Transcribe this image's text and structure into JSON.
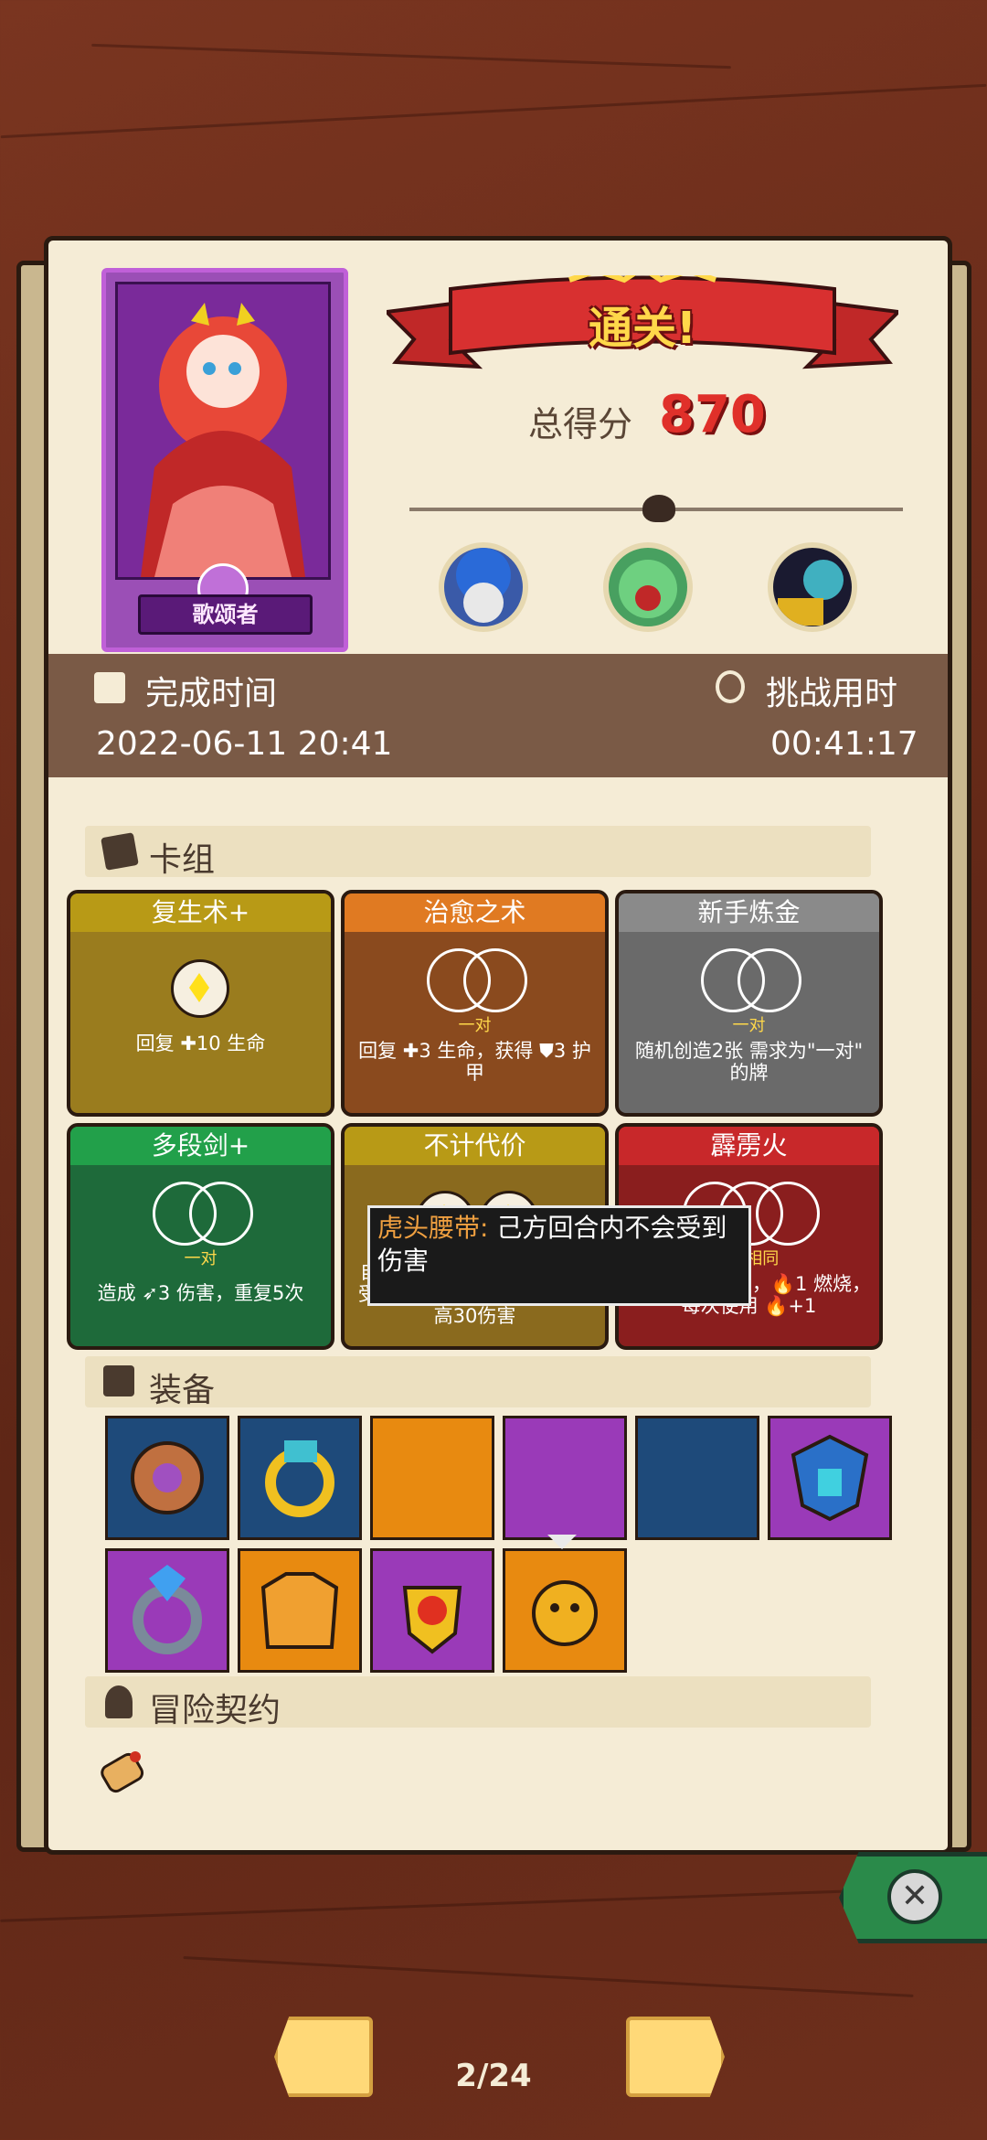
{
  "hero": {
    "name": "歌颂者"
  },
  "result": {
    "banner": "通关!",
    "score_label": "总得分",
    "score_value": "870"
  },
  "info": {
    "finish_label": "完成时间",
    "finish_value": "2022-06-11 20:41",
    "challenge_label": "挑战用时",
    "challenge_value": "00:41:17"
  },
  "sections": {
    "deck": "卡组",
    "equipment": "装备",
    "contract": "冒险契约"
  },
  "cards": [
    {
      "name": "复生术+",
      "tag": "",
      "desc": "回复 ✚10 生命",
      "color": "#9a7c1e",
      "head": "#b89a16"
    },
    {
      "name": "治愈之术",
      "tag": "一对",
      "desc": "回复 ✚3 生命，获得 ⛊3 护甲",
      "color": "#8a4a1e",
      "head": "#e07a22"
    },
    {
      "name": "新手炼金",
      "tag": "一对",
      "desc": "随机创造2张 需求为\"一对\" 的牌",
      "color": "#6a6a6a",
      "head": "#8a8a8a"
    },
    {
      "name": "多段剑+",
      "tag": "一对",
      "desc": "造成 ➶3 伤害，重复5次",
      "color": "#1e6a3a",
      "head": "#22a04a"
    },
    {
      "name": "不计代价",
      "tag": "",
      "desc": "自伤 ❤当前一半❤，对手承受其当前一半❤ 的伤害，最高30伤害",
      "color": "#8a6a1e",
      "head": "#b89a16"
    },
    {
      "name": "霹雳火",
      "tag": "3个相同",
      "desc": "造成 🔥6 伤害，🔥1 燃烧，每次使用 🔥+1",
      "color": "#8a1e1e",
      "head": "#c8282a"
    }
  ],
  "tooltip": {
    "name": "虎头腰带:",
    "text": "己方回合内不会受到伤害"
  },
  "pager": {
    "label": "2/24"
  },
  "colors": {
    "accent": "#e0302a",
    "banner": "#ffd84a",
    "panel": "#f5ecd6"
  }
}
